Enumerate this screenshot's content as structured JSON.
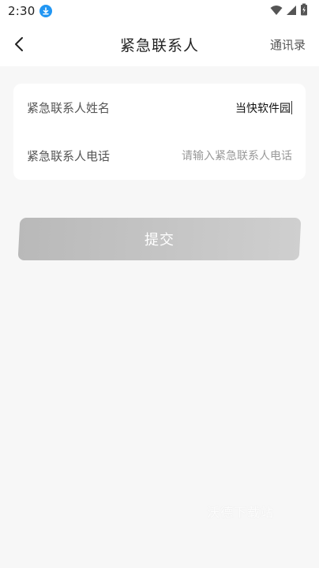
{
  "status_bar": {
    "time": "2:30",
    "icons": [
      "download-icon",
      "wifi-icon",
      "signal-icon",
      "battery-icon"
    ]
  },
  "header": {
    "title": "紧急联系人",
    "contacts_label": "通讯录"
  },
  "form": {
    "name_label": "紧急联系人姓名",
    "name_value": "当快软件园",
    "phone_label": "紧急联系人电话",
    "phone_placeholder": "请输入紧急联系人电话"
  },
  "submit_label": "提交",
  "watermark": "沃德下载站",
  "colors": {
    "download_badge": "#2196f3",
    "submit_start": "#b9b9b9",
    "submit_end": "#cfcfcf",
    "background": "#f7f7f7"
  }
}
